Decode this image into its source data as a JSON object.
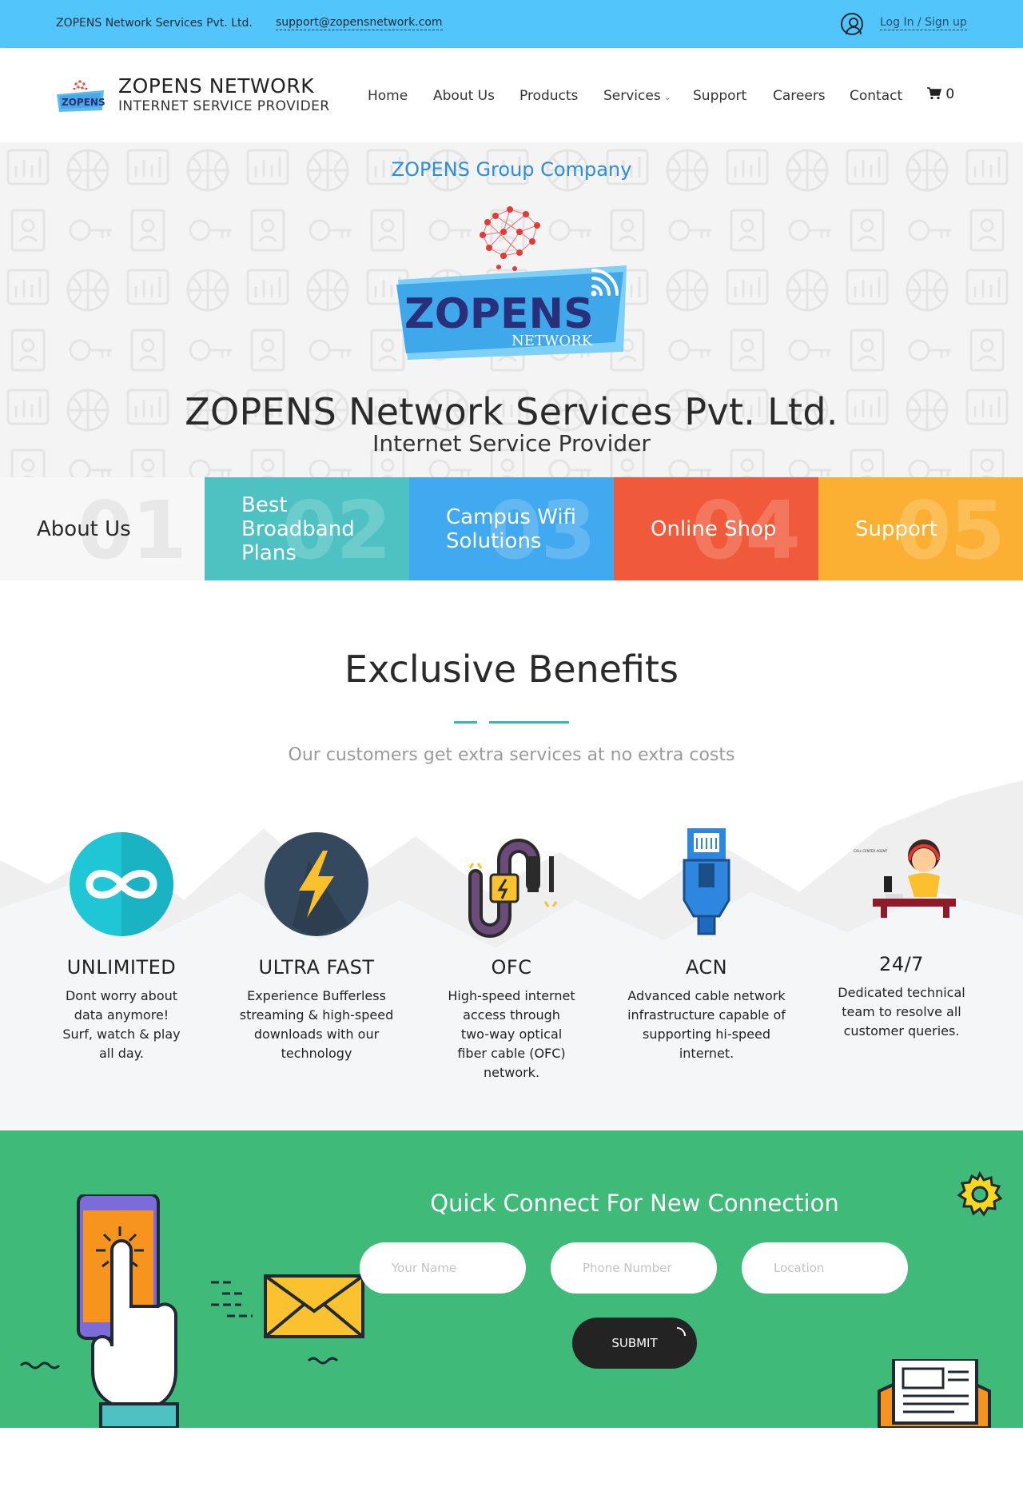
{
  "topbar": {
    "company": "ZOPENS Network Services Pvt. Ltd.",
    "email": "support@zopensnetwork.com",
    "login": "Log In / Sign up",
    "user_icon": "user-circle-icon"
  },
  "header": {
    "brand_title": "ZOPENS NETWORK",
    "brand_subtitle": "INTERNET SERVICE PROVIDER",
    "logo_text": "ZOPENS",
    "nav": [
      "Home",
      "About Us",
      "Products",
      "Services",
      "Support",
      "Careers",
      "Contact"
    ],
    "services_caret": "⌄",
    "cart_count": "0",
    "cart_icon": "cart-icon"
  },
  "hero": {
    "group": "ZOPENS Group Company",
    "logo_word": "ZOPENS",
    "logo_tag": "NETWORK",
    "title": "ZOPENS Network Services Pvt. Ltd.",
    "subtitle": "Internet Service Provider"
  },
  "tiles": [
    {
      "label": "About Us",
      "number": "01",
      "color": "#f7f7f7"
    },
    {
      "label": "Best Broadband Plans",
      "number": "02",
      "color": "#4ec2c2"
    },
    {
      "label": "Campus Wifi Solutions",
      "number": "03",
      "color": "#41a9ef"
    },
    {
      "label": "Online Shop",
      "number": "04",
      "color": "#f05a3a"
    },
    {
      "label": "Support",
      "number": "05",
      "color": "#fcb033"
    }
  ],
  "benefits": {
    "title": "Exclusive Benefits",
    "subtitle": "Our customers get extra services at no extra costs",
    "items": [
      {
        "name": "UNLIMITED",
        "desc": "Dont worry about data anymore! Surf, watch & play all day.",
        "icon": "infinity-icon"
      },
      {
        "name": "ULTRA FAST",
        "desc": "Experience Bufferless streaming & high-speed downloads with our technology",
        "icon": "lightning-icon"
      },
      {
        "name": "OFC",
        "desc": "High-speed internet access through two-way optical fiber cable (OFC) network.",
        "icon": "fiber-cable-icon"
      },
      {
        "name": "ACN",
        "desc": "Advanced cable network infrastructure capable of supporting hi-speed internet.",
        "icon": "ethernet-plug-icon"
      },
      {
        "name": "24/7",
        "desc": "Dedicated technical team to resolve all customer queries.",
        "icon": "call-center-agent-icon"
      }
    ],
    "agent_sign": "CALL CENTER AGENT"
  },
  "connect": {
    "title": "Quick Connect For New Connection",
    "name_placeholder": "Your Name",
    "phone_placeholder": "Phone Number",
    "location_placeholder": "Location",
    "submit_label": "SUBMIT"
  },
  "colors": {
    "topbar": "#52c6fa",
    "accent_blue": "#2a8fd8",
    "teal": "#3bb6b0",
    "connect_green": "#3fba78"
  }
}
